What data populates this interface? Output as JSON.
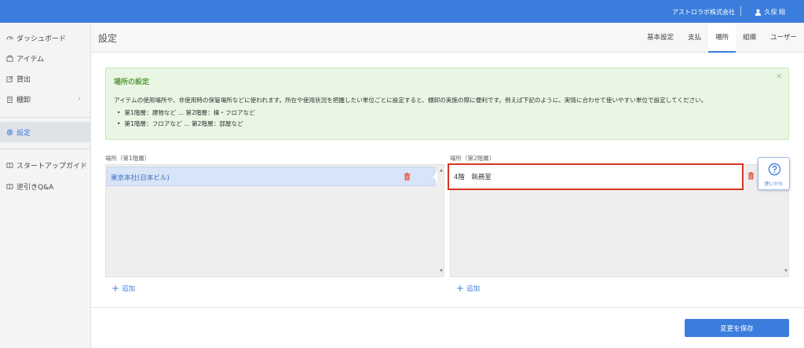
{
  "topbar": {
    "company": "アストロラボ株式会社",
    "user": "久保 翔"
  },
  "sidebar": {
    "items": [
      {
        "label": "ダッシュボード",
        "icon": "dashboard-icon"
      },
      {
        "label": "アイテム",
        "icon": "box-icon"
      },
      {
        "label": "貸出",
        "icon": "export-icon"
      },
      {
        "label": "棚卸",
        "icon": "clipboard-icon",
        "chevron": "›"
      },
      {
        "label": "設定",
        "icon": "gear-icon",
        "active": true
      },
      {
        "label": "スタートアップガイド",
        "icon": "book-icon"
      },
      {
        "label": "逆引きQ&A",
        "icon": "book-icon"
      }
    ]
  },
  "header": {
    "title": "設定",
    "tabs": [
      {
        "label": "基本設定"
      },
      {
        "label": "支払"
      },
      {
        "label": "場所",
        "active": true
      },
      {
        "label": "組織"
      },
      {
        "label": "ユーザー"
      }
    ]
  },
  "notice": {
    "title": "場所の設定",
    "close": "×",
    "body": "アイテムの使用場所や、非使用時の保管場所などに使われます。所在や使用状況を把握したい単位ごとに設定すると、棚卸の実施の際に便利です。例えば下記のように、実情に合わせて使いやすい単位で設定してください。",
    "bullets": [
      "第1階層：建物など … 第2階層：棟・フロアなど",
      "第1階層：フロアなど … 第2階層：部屋など"
    ]
  },
  "level1": {
    "label": "場所（第1階層）",
    "items": [
      "東京本社(日本ビル)"
    ],
    "add_label": "追加"
  },
  "level2": {
    "label": "場所（第2階層）",
    "items": [
      "4階　執務室"
    ],
    "add_label": "追加"
  },
  "help": {
    "label": "使いかた"
  },
  "save_label": "変更を保存",
  "colors": {
    "primary": "#3b7ddd",
    "notice_bg": "#e9f6e4",
    "highlight": "#d9341f",
    "trash": "#e05a4f"
  }
}
